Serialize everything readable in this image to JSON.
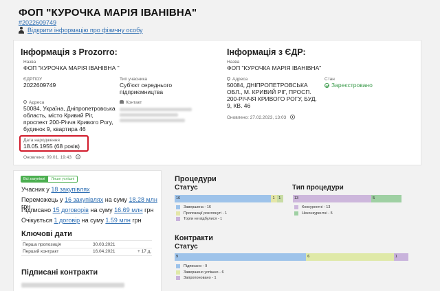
{
  "header": {
    "title": "ФОП \"КУРОЧКА МАРІЯ ІВАНІВНА\"",
    "code": "#2022609749",
    "person_link": "Відкрити інформацію про фізичну особу"
  },
  "prozorro": {
    "title": "Інформація з Prozorro:",
    "name_label": "Назва",
    "name_value": "ФОП \"КУРОЧКА МАРІЯ ІВАНІВНА \"",
    "edrpou_label": "ЄДРПОУ",
    "edrpou_value": "2022609749",
    "type_label": "Тип учасника",
    "type_value_1": "Суб'єкт середнього",
    "type_value_2": "підприємництва",
    "address_label": "Адреса",
    "address_lines": [
      "50084, Україна, Дніпропетровська",
      "область, місто Кривий Ріг,",
      "проспект 200-Річчя Кривого Рогу,",
      "будинок 9, квартира 46"
    ],
    "contact_label": "Контакт",
    "birth_label": "Дата народження",
    "birth_value": "18.05.1955 (68 років)",
    "updated": "Оновлено: 09.01. 19:43"
  },
  "edr": {
    "title": "Інформація з ЄДР:",
    "name_label": "Назва",
    "name_value": "ФОП \"КУРОЧКА МАРІЯ ІВАНІВНА\"",
    "address_label": "Адреса",
    "address_lines": [
      "50084, ДНІПРОПЕТРОВСЬКА",
      "ОБЛ., М. КРИВИЙ РІГ, ПРОСП.",
      "200-РІЧЧЯ КРИВОГО РОГУ, БУД.",
      "9, КВ. 46"
    ],
    "state_label": "Стан",
    "state_value": "Зареєстровано",
    "updated": "Оновлено: 27.02.2023, 13:03"
  },
  "stats": {
    "toggle_all": "Всі закупівлі",
    "toggle_success": "Лише успішні",
    "line1_prefix": "Учасник у",
    "line1_link": "18 закупівлях",
    "line2_prefix": "Переможець у",
    "line2_link": "16 закупівлях",
    "line2_mid": "на суму",
    "line2_sum": "18.28 млн",
    "line2_cur": "грн",
    "line3_prefix": "Підписано",
    "line3_link": "15 договорів",
    "line3_mid": "на суму",
    "line3_sum": "16.69 млн",
    "line3_cur": "грн",
    "line4_prefix": "Очікується",
    "line4_link": "1 договір",
    "line4_mid": "на суму",
    "line4_sum": "1.59 млн",
    "line4_cur": "грн"
  },
  "key_dates": {
    "title": "Ключові дати",
    "rows": [
      {
        "label": "Перша пропозиція",
        "date": "30.03.2021",
        "extra": ""
      },
      {
        "label": "Перший контракт",
        "date": "16.04.2021",
        "extra": "+ 17 д."
      }
    ]
  },
  "signed": {
    "title": "Підписані контракти"
  },
  "procedures": {
    "title": "Процедури",
    "status_title": "Статус",
    "status_bar": [
      {
        "label": "16",
        "value": 16,
        "color": "#9ec3ea"
      },
      {
        "label": "1",
        "value": 1,
        "color": "#e4e6a8"
      },
      {
        "label": "1",
        "value": 1,
        "color": "#c8dca4"
      }
    ],
    "status_legend": [
      {
        "label": "Завершена - 16",
        "color": "#9ec3ea"
      },
      {
        "label": "Пропозиції розглянуті - 1",
        "color": "#e4e6a8"
      },
      {
        "label": "Торги не відбулися - 1",
        "color": "#c9b3dc"
      }
    ],
    "type_title": "Тип процедури",
    "type_bar": [
      {
        "label": "13",
        "value": 13,
        "color": "#cdb7dc"
      },
      {
        "label": "5",
        "value": 5,
        "color": "#9fd0a3"
      }
    ],
    "type_legend": [
      {
        "label": "Конкурентні - 13",
        "color": "#cdb7dc"
      },
      {
        "label": "Неконкурентні - 5",
        "color": "#9fd0a3"
      }
    ]
  },
  "contracts": {
    "title": "Контракти",
    "status_title": "Статус",
    "bar": [
      {
        "label": "9",
        "value": 9,
        "color": "#9ec3ea"
      },
      {
        "label": "6",
        "value": 6,
        "color": "#dfe9a8"
      },
      {
        "label": "1",
        "value": 1,
        "color": "#c9b3dc"
      }
    ],
    "legend": [
      {
        "label": "Підписано - 9",
        "color": "#9ec3ea"
      },
      {
        "label": "Завершено успішно - 6",
        "color": "#dfe9a8"
      },
      {
        "label": "Запропоновано - 1",
        "color": "#c9b3dc"
      }
    ]
  }
}
